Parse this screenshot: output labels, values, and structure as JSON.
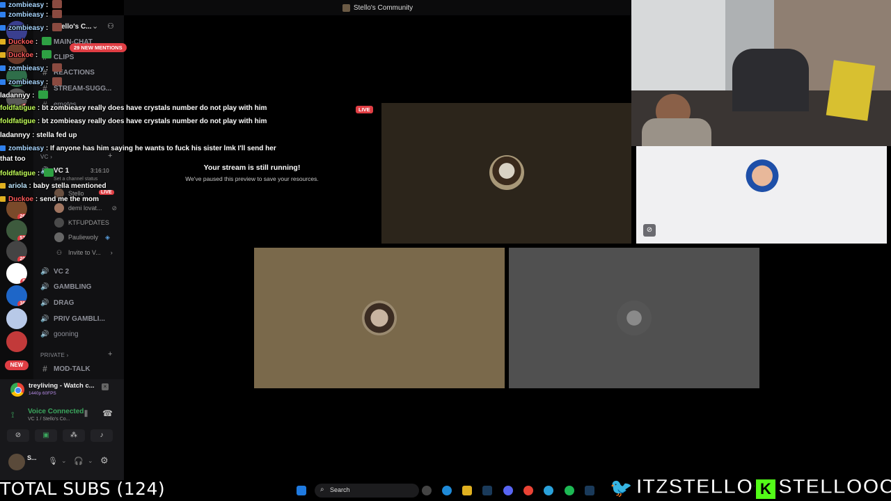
{
  "window": {
    "title": "Stello's Community"
  },
  "server": {
    "name": "Stello's C...",
    "mentions": "29 NEW MENTIONS"
  },
  "channels_top": [
    {
      "label": "MAIN-CHAT"
    },
    {
      "label": "CLIPS"
    },
    {
      "label": "REACTIONS"
    },
    {
      "label": "STREAM-SUGG..."
    },
    {
      "label": "emotes"
    }
  ],
  "voice": {
    "category": "VC",
    "channel": "VC 1",
    "timer": "3:16:10",
    "status_hint": "Set a channel status",
    "streamer": "Stello",
    "live_label": "LIVE",
    "users": [
      "demi lovat...",
      "KTFUPDATES",
      "Pauliewoly"
    ],
    "invite": "Invite to V..."
  },
  "channels_voice": [
    "VC 2",
    "GAMBLING",
    "DRAG",
    "PRIV GAMBLI...",
    "gooning"
  ],
  "private": {
    "category": "PRIVATE",
    "channel": "MOD-TALK"
  },
  "rail": {
    "badges": [
      "22",
      "261",
      "525",
      "206",
      "93",
      "383"
    ],
    "new_label": "NEW"
  },
  "stream_card": {
    "title": "treyliving - Watch c...",
    "quality": "1440p 60FPS"
  },
  "voice_connection": {
    "title": "Voice Connected",
    "subtitle": "VC 1 / Stello's Co..."
  },
  "me": {
    "name": "S..."
  },
  "chat": [
    {
      "user": "zombieasy",
      "text": "",
      "cls": "user-z",
      "emote": true
    },
    {
      "user": "zombieasy",
      "text": "",
      "cls": "user-z",
      "emote": true
    },
    {
      "user": "zombieasy",
      "text": "",
      "cls": "user-z",
      "emote": true
    },
    {
      "user": "Duckoe",
      "text": "",
      "cls": "user-d",
      "emote": true
    },
    {
      "user": "Duckoe",
      "text": "",
      "cls": "user-d",
      "emote": true
    },
    {
      "user": "zombieasy",
      "text": "",
      "cls": "user-z",
      "emote": true
    },
    {
      "user": "zombieasy",
      "text": "",
      "cls": "user-z",
      "emote": true
    },
    {
      "user": "ladannyy",
      "text": "",
      "cls": "user-l",
      "emote": true
    },
    {
      "user": "foldfatigue",
      "text": "bt zombieasy really does have crystals number do not play with him",
      "cls": "user-f",
      "emote": false
    },
    {
      "user": "foldfatigue",
      "text": "bt zombieasy really does have crystals number do not play with him",
      "cls": "user-f",
      "emote": false
    },
    {
      "user": "ladannyy",
      "text": "stella fed up",
      "cls": "user-l",
      "emote": false
    },
    {
      "user": "zombieasy",
      "text": "If anyone has him saying he wants to fuck his sister lmk I'll send her",
      "cls": "user-z",
      "emote": false
    },
    {
      "user": "that too",
      "text": "",
      "cls": "user-l",
      "emote": false
    },
    {
      "user": "foldfatigue",
      "text": "",
      "cls": "user-f",
      "emote": true
    },
    {
      "user": "ariola",
      "text": "baby stella mentioned",
      "cls": "user-a",
      "emote": false
    },
    {
      "user": "Duckoe",
      "text": "send me the mom",
      "cls": "user-d",
      "emote": false
    }
  ],
  "stream": {
    "live": "LIVE",
    "paused_title": "Your stream is still running!",
    "paused_sub": "We've paused this preview to save your resources."
  },
  "taskbar": {
    "search": "Search"
  },
  "overlay": {
    "total_subs": "TOTAL SUBS (124)",
    "twitter": "ITZSTELLOO",
    "kick": "STELLOOO"
  },
  "colors": {
    "accent_red": "#e03e44",
    "tile1": "#2c251b",
    "tile2": "#7a694b",
    "tile3": "#505050",
    "tile4": "#f0f0f2"
  }
}
